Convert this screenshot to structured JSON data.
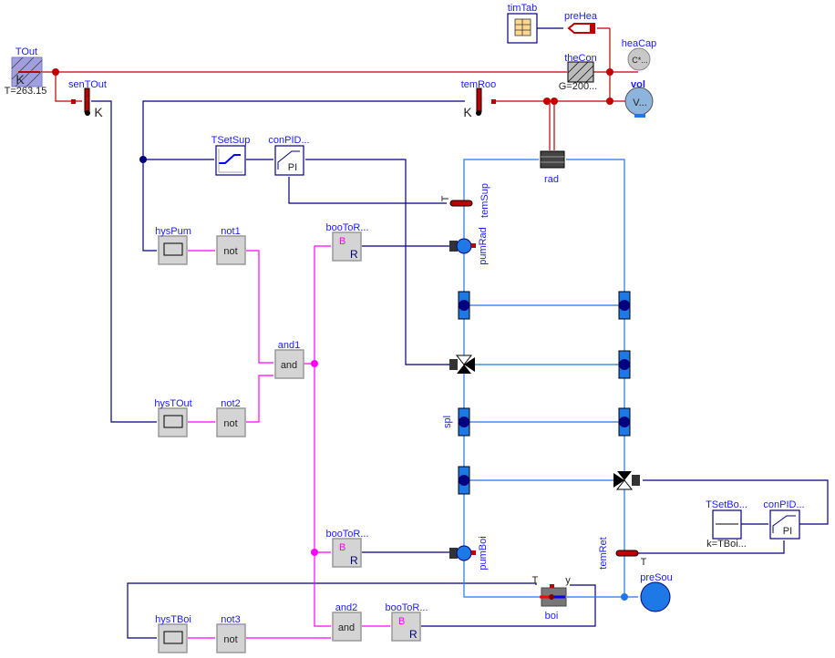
{
  "components": {
    "TOut": {
      "name": "TOut",
      "param": "T=263.15",
      "unit": "K"
    },
    "senTOut": {
      "name": "senTOut",
      "unit": "K"
    },
    "temRoo": {
      "name": "temRoo",
      "unit": "K"
    },
    "timTab": {
      "name": "timTab"
    },
    "preHea": {
      "name": "preHea"
    },
    "theCon": {
      "name": "theCon",
      "param": "G=200..."
    },
    "heaCap": {
      "name": "heaCap",
      "text": "C*..."
    },
    "vol": {
      "name": "vol",
      "text": "V..."
    },
    "rad": {
      "name": "rad"
    },
    "TSetSup": {
      "name": "TSetSup"
    },
    "conPIDRad": {
      "name": "conPID...",
      "text": "PI"
    },
    "temSup": {
      "name": "temSup",
      "port": "T"
    },
    "pumRad": {
      "name": "pumRad"
    },
    "spl": {
      "name": "spl"
    },
    "pumBoi": {
      "name": "pumBoi"
    },
    "temRet": {
      "name": "temRet",
      "port": "T"
    },
    "preSou": {
      "name": "preSou"
    },
    "boi": {
      "name": "boi",
      "port_T": "T",
      "port_y": "y"
    },
    "TSetBoi": {
      "name": "TSetBo...",
      "param": "k=TBoi..."
    },
    "conPIDBoi": {
      "name": "conPID...",
      "text": "PI"
    },
    "hysPum": {
      "name": "hysPum"
    },
    "hysTOut": {
      "name": "hysTOut"
    },
    "hysTBoi": {
      "name": "hysTBoi"
    },
    "not1": {
      "name": "not1",
      "text": "not"
    },
    "not2": {
      "name": "not2",
      "text": "not"
    },
    "not3": {
      "name": "not3",
      "text": "not"
    },
    "and1": {
      "name": "and1",
      "text": "and"
    },
    "and2": {
      "name": "and2",
      "text": "and"
    },
    "booToR1": {
      "name": "booToR...",
      "in": "B",
      "out": "R"
    },
    "booToR2": {
      "name": "booToR...",
      "in": "B",
      "out": "R"
    },
    "booToR3": {
      "name": "booToR...",
      "in": "B",
      "out": "R"
    }
  },
  "colors": {
    "heat": "#c00000",
    "signal": "#00007f",
    "boolean": "#ff00ff",
    "fluid": "#1e78e6",
    "label": "#1a1aff"
  }
}
